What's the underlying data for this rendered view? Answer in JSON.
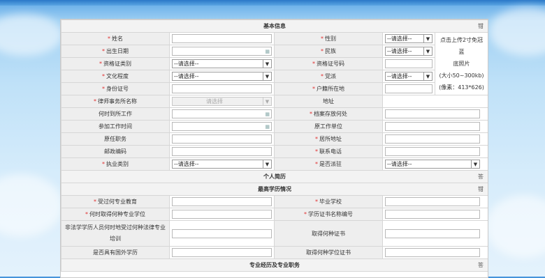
{
  "sections": {
    "basic": "基本信息",
    "resume": "个人简历",
    "education": "最高学历情况",
    "profession": "专业经历及专业职务"
  },
  "toggles": {
    "collapse": "钳",
    "expand": "答"
  },
  "photo": {
    "line1": "点击上传2寸免冠蓝",
    "line2": "底照片",
    "line3": "(大小50~300kb)",
    "line4": "(像素：413*626)"
  },
  "labels": {
    "name": "姓名",
    "gender": "性别",
    "birth": "出生日期",
    "ethnic": "民族",
    "cert_type": "资格证类别",
    "cert_no": "资格证号码",
    "education_level": "文化程度",
    "party": "党派",
    "id_no": "身份证号",
    "hukou": "户籍所在地",
    "firm": "律师事务所名称",
    "address": "地址",
    "join_time": "何时到所工作",
    "archive": "档案存放何处",
    "work_start": "参加工作时间",
    "orig_unit": "原工作单位",
    "orig_post": "原任职务",
    "residence": "居所地址",
    "postcode": "邮政编码",
    "phone": "联系电话",
    "practice_type": "执业类别",
    "dispatched": "是否派驻",
    "major_edu": "受过何专业教育",
    "school": "毕业学校",
    "degree_time": "何时取得何种专业学位",
    "diploma_no": "学历证书名称编号",
    "nonlaw_training": "非法学学历人员何时地受过何种法律专业培训",
    "cert_obtained": "取得何种证书",
    "foreign_edu": "是否具有国外学历",
    "degree_cert": "取得何种学位证书"
  },
  "select_placeholder": "--请选择--",
  "firm_placeholder": "请选择"
}
